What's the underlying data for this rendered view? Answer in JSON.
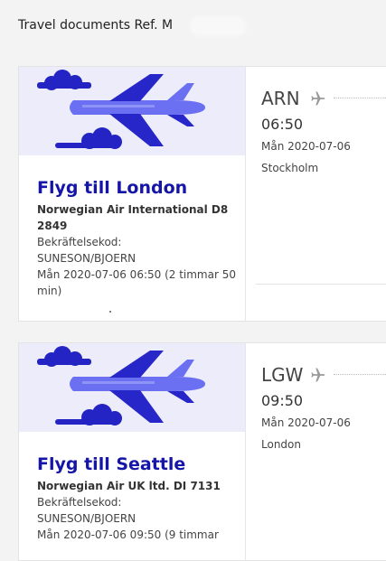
{
  "header": {
    "title": "Travel documents Ref. M"
  },
  "flights": [
    {
      "title": "Flyg till London",
      "airline": "Norwegian Air International D8 2849",
      "confirmation_label": "Bekräftelsekod:",
      "confirmation_value": "SUNESON/BJOERN",
      "datetime": "Mån 2020-07-06 06:50 (2 timmar 50 min)",
      "origin_code": "ARN",
      "origin_time": "06:50",
      "origin_date": "Mån 2020-07-06",
      "origin_city": "Stockholm",
      "icon": "plane-icon"
    },
    {
      "title": "Flyg till Seattle",
      "airline": "Norwegian Air UK ltd. DI 7131",
      "confirmation_label": "Bekräftelsekod:",
      "confirmation_value": "SUNESON/BJOERN",
      "datetime": "Mån 2020-07-06 09:50 (9 timmar",
      "origin_code": "LGW",
      "origin_time": "09:50",
      "origin_date": "Mån 2020-07-06",
      "origin_city": "London",
      "icon": "plane-icon"
    }
  ],
  "colors": {
    "title": "#1515a8",
    "plane_light": "#6b6ff2",
    "plane_dark": "#2626c9",
    "cloud": "#2424c4",
    "art_bg": "#ececfa"
  }
}
